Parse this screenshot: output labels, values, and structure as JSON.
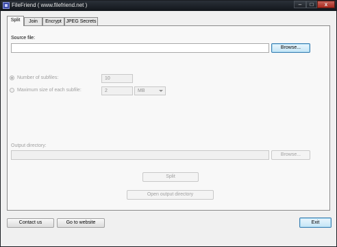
{
  "window": {
    "title": "FileFriend ( www.filefriend.net )",
    "controls": {
      "minimize": "–",
      "maximize": "□",
      "close": "x"
    }
  },
  "tabs": [
    {
      "label": "Split",
      "active": true
    },
    {
      "label": "Join"
    },
    {
      "label": "Encrypt"
    },
    {
      "label": "JPEG Secrets"
    }
  ],
  "split": {
    "source_label": "Source file:",
    "source_value": "",
    "browse_label": "Browse...",
    "options": {
      "number_label": "Number of subfiles:",
      "number_value": "10",
      "maxsize_label": "Maximum size of each subfile:",
      "maxsize_value": "2",
      "unit_value": "MB"
    },
    "output_label": "Output directory:",
    "output_value": "",
    "output_browse_label": "Browse...",
    "split_button": "Split",
    "open_output_button": "Open output directory"
  },
  "footer": {
    "contact_label": "Contact us",
    "website_label": "Go to website",
    "exit_label": "Exit"
  }
}
